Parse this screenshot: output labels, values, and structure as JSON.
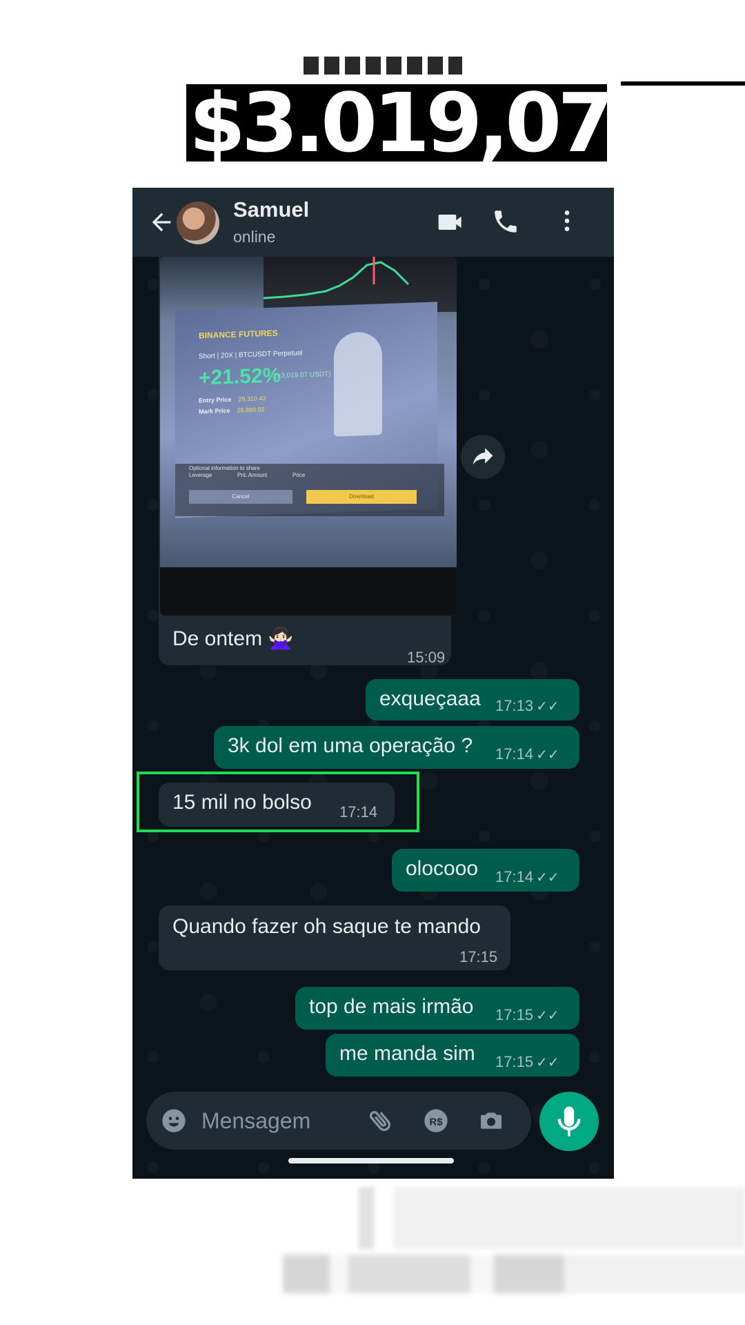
{
  "banner": {
    "amount": "$3.019,07"
  },
  "header": {
    "contact_name": "Samuel",
    "status": "online"
  },
  "media_message": {
    "screenshot": {
      "brand": "BINANCE FUTURES",
      "position_line": "Short | 20X | BTCUSDT Perpetual",
      "pnl_percent": "+21.52%",
      "pnl_usdt": "(+3,019.07 USDT)",
      "entry_label": "Entry Price",
      "entry_value": "29,310.43",
      "mark_label": "Mark Price",
      "mark_value": "28,889.92",
      "options_title": "Optional information to share",
      "opt_leverage": "Leverage",
      "opt_amount": "PnL Amount",
      "opt_price": "Price",
      "cancel_label": "Cancel",
      "download_label": "Download"
    },
    "caption": "De ontem 🙅🏻‍♀️",
    "time": "15:09"
  },
  "messages": [
    {
      "text": "exqueçaaa",
      "time": "17:13",
      "direction": "out"
    },
    {
      "text": "3k dol em uma operação ?",
      "time": "17:14",
      "direction": "out"
    },
    {
      "text": "15 mil no bolso",
      "time": "17:14",
      "direction": "in"
    },
    {
      "text": "olocooo",
      "time": "17:14",
      "direction": "out"
    },
    {
      "text": "Quando fazer oh saque te mando",
      "time": "17:15",
      "direction": "in"
    },
    {
      "text": "top de mais irmão",
      "time": "17:15",
      "direction": "out"
    },
    {
      "text": "me manda sim",
      "time": "17:15",
      "direction": "out"
    }
  ],
  "composer": {
    "placeholder": "Mensagem"
  },
  "icons": {
    "back": "arrow-left-icon",
    "video": "video-call-icon",
    "call": "phone-icon",
    "menu": "more-vert-icon",
    "emoji": "emoji-icon",
    "attach": "paperclip-icon",
    "payment": "rs-payment-icon",
    "camera": "camera-icon",
    "mic": "mic-icon",
    "forward": "forward-icon",
    "read": "double-check-icon"
  },
  "colors": {
    "chat_bg": "#0b141a",
    "appbar": "#1f2c34",
    "incoming": "#202c33",
    "outgoing": "#005c4b",
    "accent": "#00a884",
    "highlight": "#1fdb4f"
  }
}
